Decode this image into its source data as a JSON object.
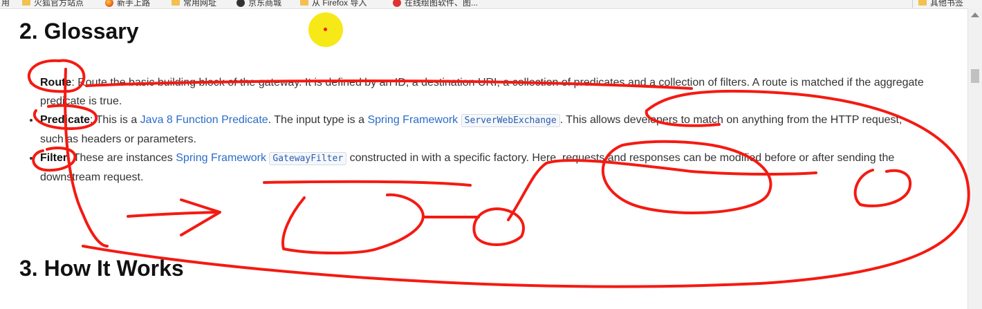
{
  "bookmarks": [
    {
      "label": "用",
      "icon": "none"
    },
    {
      "label": "火狐官方站点",
      "icon": "folder-icon"
    },
    {
      "label": "新手上路",
      "icon": "firefox-icon"
    },
    {
      "label": "常用网址",
      "icon": "folder-icon"
    },
    {
      "label": "京东商城",
      "icon": "jd-icon"
    },
    {
      "label": "从 Firefox 导入",
      "icon": "folder-icon"
    },
    {
      "label": "在线绘图软件、图...",
      "icon": "tool-icon"
    }
  ],
  "other_bookmarks": "其他书签",
  "headings": {
    "glossary": "2. Glossary",
    "how_it_works": "3. How It Works"
  },
  "glossary": {
    "route": {
      "term": "Route",
      "text": ": Route the basic building block of the gateway. It is defined by an ID, a destination URI, a collection of predicates and a collection of filters. A route is matched if the aggregate predicate is true."
    },
    "predicate": {
      "term": "Predicate",
      "text1": ": This is a ",
      "link1": "Java 8 Function Predicate",
      "text2": ". The input type is a ",
      "link2": "Spring Framework",
      "code": "ServerWebExchange",
      "text3": ". This allows developers to match on anything from the HTTP request, such as headers or parameters."
    },
    "filter": {
      "term": "Filter",
      "text1": ": These are instances ",
      "link1": "Spring Framework",
      "code": "GatewayFilter",
      "text2": " constructed in with a specific factory. Here, requests and responses can be modified before or after sending the downstream request."
    }
  },
  "colors": {
    "annotation": "#f41a12",
    "link": "#2a6cc9",
    "cursor_highlight": "#f7e600"
  }
}
